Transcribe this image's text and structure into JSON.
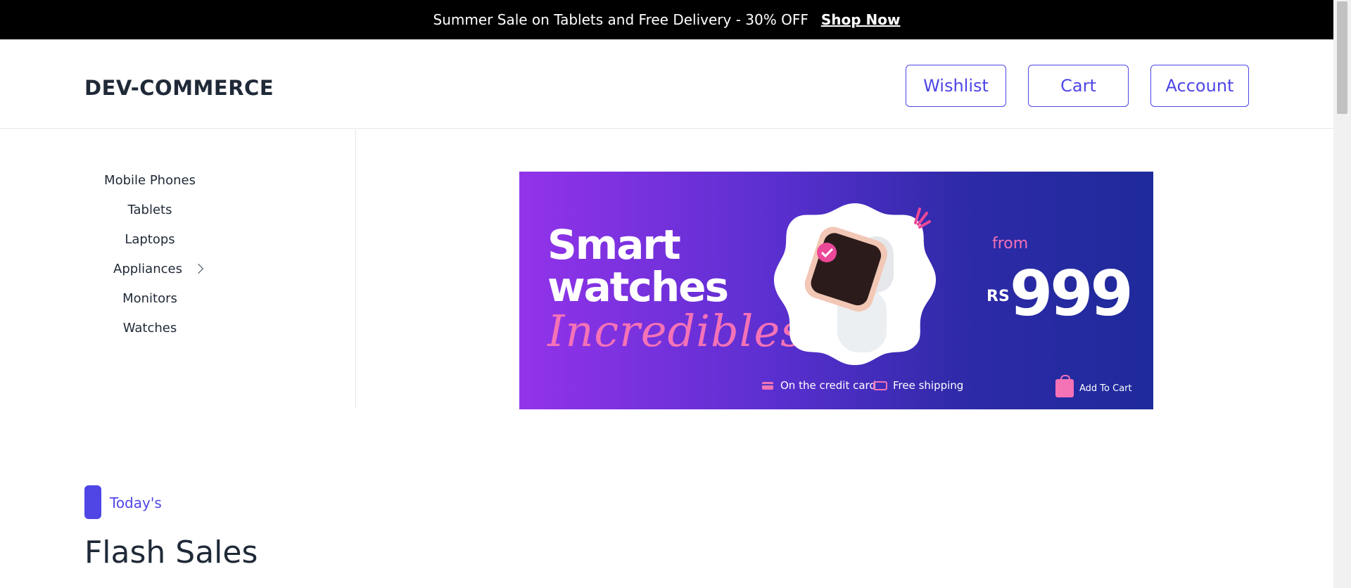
{
  "announcement": {
    "message": "Summer Sale on Tablets and Free Delivery - 30% OFF",
    "link_label": "Shop Now"
  },
  "header": {
    "logo": "DEV-COMMERCE",
    "buttons": {
      "wishlist": "Wishlist",
      "cart": "Cart",
      "account": "Account"
    }
  },
  "sidebar": {
    "categories": [
      {
        "label": "Mobile Phones"
      },
      {
        "label": "Tablets"
      },
      {
        "label": "Laptops"
      },
      {
        "label": "Appliances",
        "has_submenu": true
      },
      {
        "label": "Monitors"
      },
      {
        "label": "Watches"
      }
    ]
  },
  "banner": {
    "headline_line1": "Smart",
    "headline_line2": "watches",
    "script_text": "Incredibles",
    "from_label": "from",
    "currency": "RS",
    "price": "999",
    "features": {
      "credit": "On the credit card",
      "shipping": "Free shipping",
      "add_to_cart": "Add To Cart"
    },
    "icons": [
      "credit-card-icon",
      "truck-icon",
      "shopping-bag-icon"
    ]
  },
  "section": {
    "eyebrow": "Today's",
    "title": "Flash Sales"
  },
  "colors": {
    "accent": "#4f46e5",
    "topbar_bg": "#000000",
    "banner_pink": "#f472b6",
    "banner_gradient_start": "#9333ea",
    "banner_gradient_end": "#1e2a9a"
  }
}
